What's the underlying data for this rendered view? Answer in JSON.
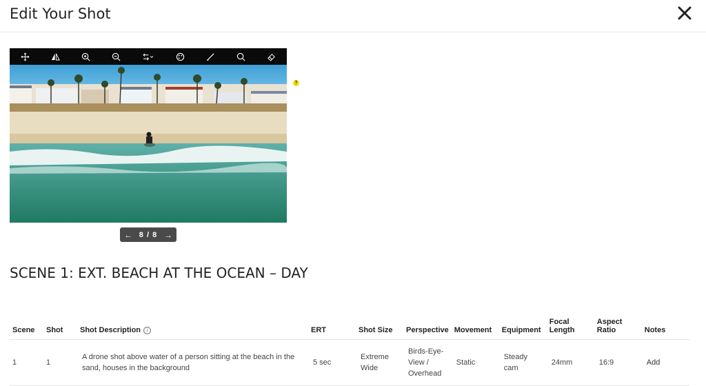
{
  "header": {
    "title": "Edit Your Shot"
  },
  "toolbar": {
    "tools": [
      "move-icon",
      "flip-icon",
      "zoom-in-icon",
      "zoom-out-icon",
      "swap-icon",
      "palette-icon",
      "brush-icon",
      "search-icon",
      "eraser-icon"
    ]
  },
  "help": {
    "label": "?"
  },
  "pager": {
    "prev": "←",
    "count": "8 / 8",
    "next": "→"
  },
  "scene": {
    "heading": "SCENE 1:  EXT. BEACH AT THE OCEAN – DAY"
  },
  "table": {
    "columns": {
      "scene": "Scene",
      "shot": "Shot",
      "description": "Shot Description",
      "info": "i",
      "ert": "ERT",
      "shot_size": "Shot Size",
      "perspective": "Perspective",
      "movement": "Movement",
      "equipment": "Equipment",
      "focal_length": "Focal Length",
      "aspect_ratio": "Aspect Ratio",
      "notes": "Notes"
    },
    "rows": [
      {
        "scene": "1",
        "shot": "1",
        "description": "A drone shot above water of a person sitting at the beach in the sand, houses in the background",
        "ert": "5 sec",
        "shot_size": "Extreme Wide",
        "perspective": "Birds-Eye-View / Overhead",
        "movement": "Static",
        "equipment": "Steady cam",
        "focal_length": "24mm",
        "aspect_ratio": "16:9",
        "notes": "Add"
      }
    ]
  }
}
